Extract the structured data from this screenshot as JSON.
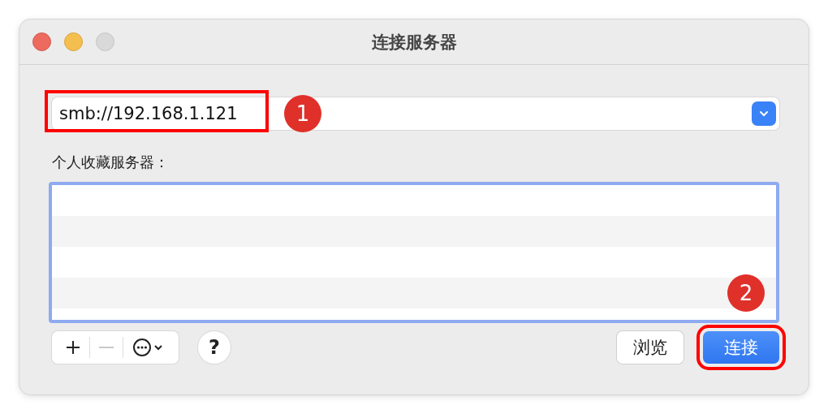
{
  "window": {
    "title": "连接服务器"
  },
  "server_address": {
    "value": "smb://192.168.1.121",
    "highlighted": true,
    "badge": "1"
  },
  "favorites": {
    "label": "个人收藏服务器："
  },
  "toolbar": {
    "add": {
      "disabled": false
    },
    "remove": {
      "disabled": true
    },
    "help": "?"
  },
  "buttons": [
    {
      "label": "浏览",
      "kind": "normal",
      "highlighted": false
    },
    {
      "label": "连接",
      "kind": "primary",
      "highlighted": true,
      "badge": "2"
    }
  ]
}
